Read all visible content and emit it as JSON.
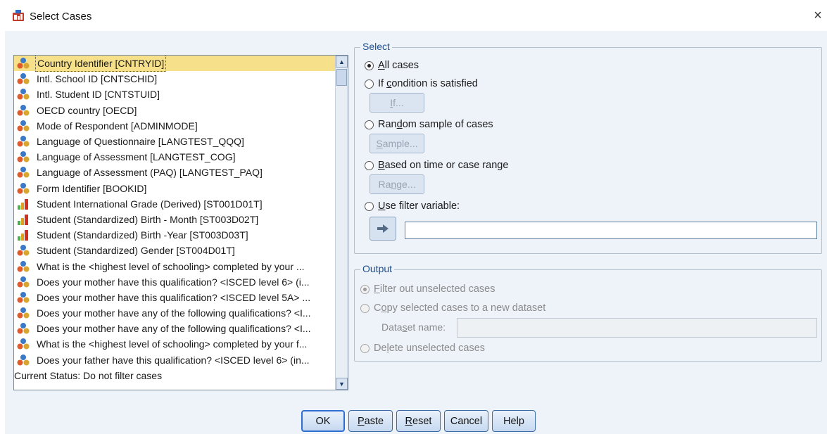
{
  "window": {
    "title": "Select Cases",
    "close_glyph": "×"
  },
  "variables": [
    {
      "label": "Country Identifier [CNTRYID]",
      "icon": "nominal-icon",
      "selected": true
    },
    {
      "label": "Intl. School ID [CNTSCHID]",
      "icon": "nominal-icon"
    },
    {
      "label": "Intl. Student ID [CNTSTUID]",
      "icon": "nominal-icon"
    },
    {
      "label": "OECD country [OECD]",
      "icon": "nominal-icon"
    },
    {
      "label": "Mode of Respondent [ADMINMODE]",
      "icon": "nominal-icon"
    },
    {
      "label": "Language of Questionnaire [LANGTEST_QQQ]",
      "icon": "nominal-icon"
    },
    {
      "label": "Language of Assessment [LANGTEST_COG]",
      "icon": "nominal-icon"
    },
    {
      "label": "Language of Assessment (PAQ) [LANGTEST_PAQ]",
      "icon": "nominal-icon"
    },
    {
      "label": "Form Identifier [BOOKID]",
      "icon": "nominal-icon"
    },
    {
      "label": "Student International Grade (Derived) [ST001D01T]",
      "icon": "ordinal-icon"
    },
    {
      "label": "Student (Standardized) Birth - Month [ST003D02T]",
      "icon": "ordinal-icon"
    },
    {
      "label": "Student (Standardized) Birth -Year [ST003D03T]",
      "icon": "ordinal-icon"
    },
    {
      "label": "Student (Standardized) Gender [ST004D01T]",
      "icon": "nominal-icon"
    },
    {
      "label": "What is the <highest level of schooling> completed by your ...",
      "icon": "nominal-icon"
    },
    {
      "label": "Does your mother have this qualification? <ISCED level 6> (i...",
      "icon": "nominal-icon"
    },
    {
      "label": "Does your mother have this qualification? <ISCED level 5A> ...",
      "icon": "nominal-icon"
    },
    {
      "label": "Does your mother have any of the following qualifications? <I...",
      "icon": "nominal-icon"
    },
    {
      "label": "Does your mother have any of the following qualifications? <I...",
      "icon": "nominal-icon"
    },
    {
      "label": "What is the <highest level of schooling> completed by your f...",
      "icon": "nominal-icon"
    },
    {
      "label": "Does your father have this qualification? <ISCED level 6> (in...",
      "icon": "nominal-icon"
    }
  ],
  "status": "Current Status: Do not filter cases",
  "select_group": {
    "legend": "Select",
    "all_cases": {
      "pre": "",
      "u": "A",
      "post": "ll cases"
    },
    "if_condition": {
      "pre": "If ",
      "u": "c",
      "post": "ondition is satisfied"
    },
    "if_button": {
      "pre": "",
      "u": "I",
      "post": "f..."
    },
    "random_sample": {
      "pre": "Ran",
      "u": "d",
      "post": "om sample of cases"
    },
    "sample_button": {
      "pre": "",
      "u": "S",
      "post": "ample..."
    },
    "time_range": {
      "pre": "",
      "u": "B",
      "post": "ased on time or case range"
    },
    "range_button": {
      "pre": "Ra",
      "u": "n",
      "post": "ge..."
    },
    "filter_variable": {
      "pre": "",
      "u": "U",
      "post": "se filter variable:"
    },
    "filter_value": ""
  },
  "output_group": {
    "legend": "Output",
    "filter_out": {
      "pre": "",
      "u": "F",
      "post": "ilter out unselected cases"
    },
    "copy": {
      "pre": "C",
      "u": "o",
      "post": "py selected cases to a new dataset"
    },
    "dataset_label": {
      "pre": "Data",
      "u": "s",
      "post": "et name:"
    },
    "dataset_value": "",
    "delete": {
      "pre": "De",
      "u": "l",
      "post": "ete unselected cases"
    }
  },
  "buttons": {
    "ok": {
      "pre": "OK",
      "u": "",
      "post": ""
    },
    "paste": {
      "pre": "",
      "u": "P",
      "post": "aste"
    },
    "reset": {
      "pre": "",
      "u": "R",
      "post": "eset"
    },
    "cancel": {
      "pre": "Cancel",
      "u": "",
      "post": ""
    },
    "help": {
      "pre": "Help",
      "u": "",
      "post": ""
    }
  },
  "colors": {
    "dialog_bg": "#eef3fa",
    "selected_row": "#f7e08a",
    "legend_text": "#1f4e8c"
  }
}
